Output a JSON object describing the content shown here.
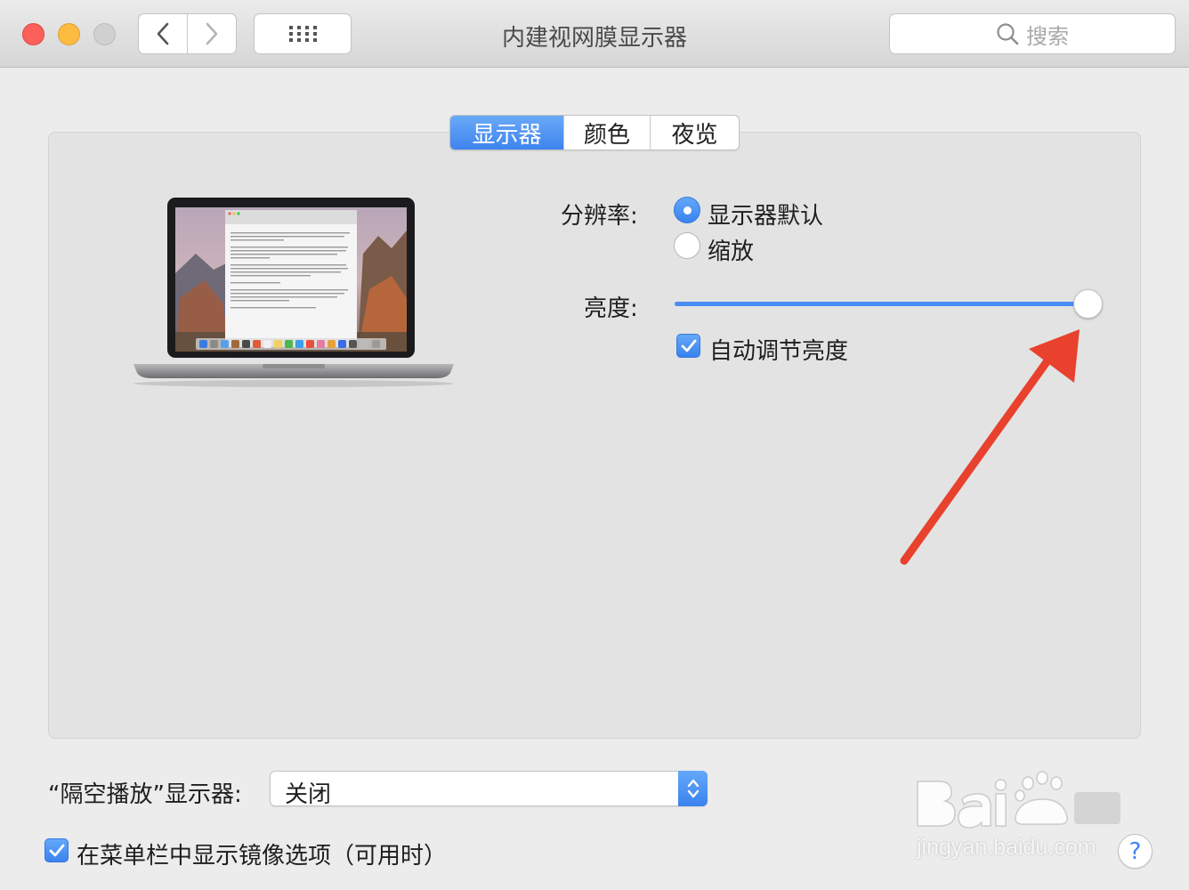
{
  "window": {
    "title": "内建视网膜显示器",
    "search_placeholder": "搜索"
  },
  "tabs": [
    {
      "label": "显示器",
      "active": true
    },
    {
      "label": "颜色",
      "active": false
    },
    {
      "label": "夜览",
      "active": false
    }
  ],
  "display": {
    "resolution_label": "分辨率:",
    "resolution_options": [
      {
        "label": "显示器默认",
        "selected": true
      },
      {
        "label": "缩放",
        "selected": false
      }
    ],
    "brightness_label": "亮度:",
    "brightness_value": 1.0,
    "auto_brightness_label": "自动调节亮度",
    "auto_brightness_checked": true
  },
  "airplay": {
    "label": "“隔空播放”显示器:",
    "value": "关闭"
  },
  "mirroring": {
    "label": "在菜单栏中显示镜像选项（可用时）",
    "checked": true
  },
  "watermark": {
    "url": "jingyan.baidu.com"
  },
  "colors": {
    "accent": "#3e84ee",
    "annotation_arrow": "#e8412d"
  }
}
